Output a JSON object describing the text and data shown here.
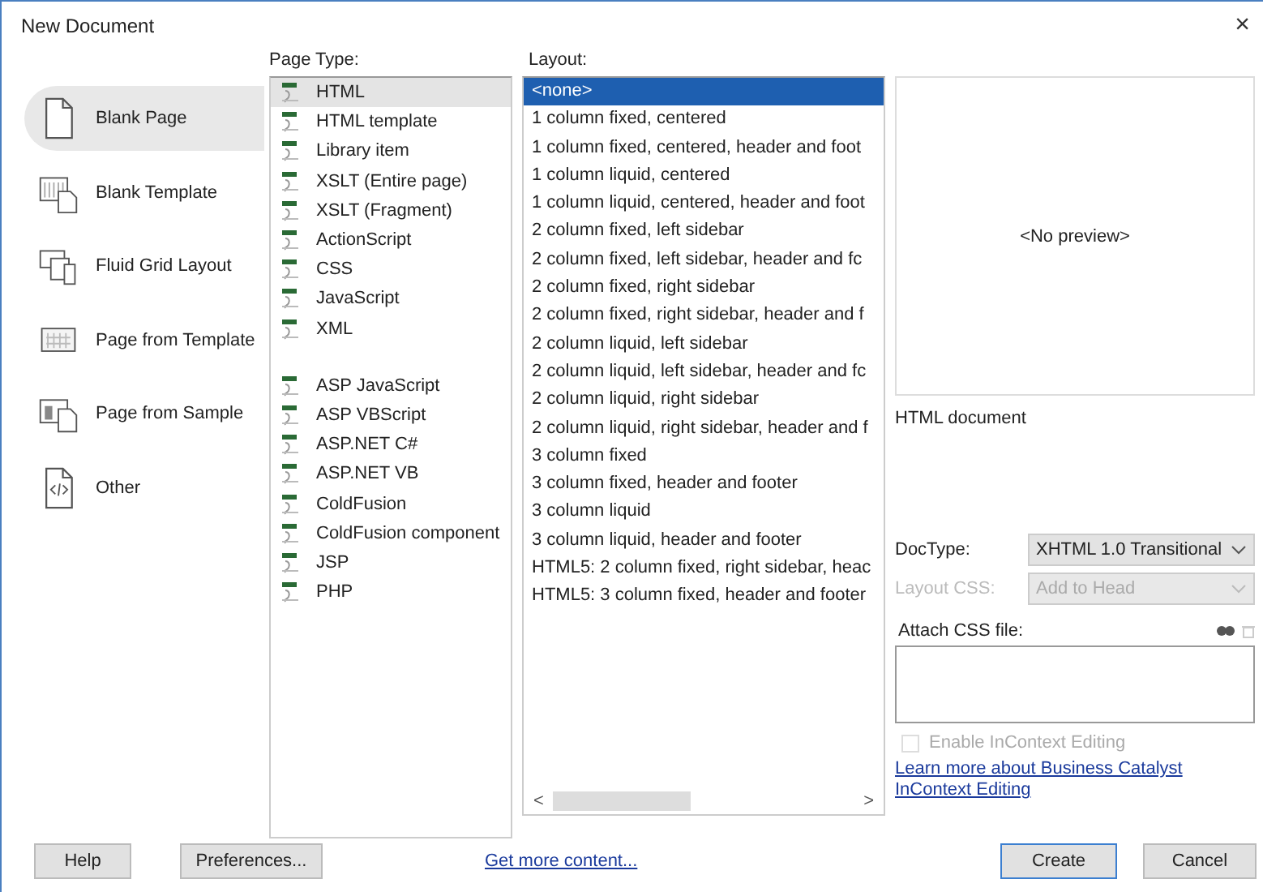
{
  "window": {
    "title": "New Document",
    "close": "×"
  },
  "categories": [
    {
      "label": "Blank Page",
      "kind": "page",
      "selected": true
    },
    {
      "label": "Blank Template",
      "kind": "template",
      "selected": false
    },
    {
      "label": "Fluid Grid Layout",
      "kind": "fluid",
      "selected": false
    },
    {
      "label": "Page from Template",
      "kind": "grid",
      "selected": false
    },
    {
      "label": "Page from Sample",
      "kind": "sample",
      "selected": false
    },
    {
      "label": "Other",
      "kind": "code",
      "selected": false
    }
  ],
  "page_type": {
    "label": "Page Type:",
    "groups": [
      {
        "items": [
          {
            "label": "HTML",
            "selected": true
          },
          {
            "label": "HTML template",
            "selected": false
          },
          {
            "label": "Library item",
            "selected": false
          },
          {
            "label": "XSLT (Entire page)",
            "selected": false
          },
          {
            "label": "XSLT (Fragment)",
            "selected": false
          },
          {
            "label": "ActionScript",
            "selected": false
          },
          {
            "label": "CSS",
            "selected": false
          },
          {
            "label": "JavaScript",
            "selected": false
          },
          {
            "label": "XML",
            "selected": false
          }
        ]
      },
      {
        "items": [
          {
            "label": "ASP JavaScript",
            "selected": false
          },
          {
            "label": "ASP VBScript",
            "selected": false
          },
          {
            "label": "ASP.NET C#",
            "selected": false
          },
          {
            "label": "ASP.NET VB",
            "selected": false
          },
          {
            "label": "ColdFusion",
            "selected": false
          },
          {
            "label": "ColdFusion component",
            "selected": false
          },
          {
            "label": "JSP",
            "selected": false
          },
          {
            "label": "PHP",
            "selected": false
          }
        ]
      }
    ]
  },
  "layout": {
    "label": "Layout:",
    "items": [
      {
        "label": "<none>",
        "selected": true
      },
      {
        "label": "1 column fixed, centered",
        "selected": false
      },
      {
        "label": "1 column fixed, centered, header and foot",
        "selected": false
      },
      {
        "label": "1 column liquid, centered",
        "selected": false
      },
      {
        "label": "1 column liquid, centered, header and foot",
        "selected": false
      },
      {
        "label": "2 column fixed, left sidebar",
        "selected": false
      },
      {
        "label": "2 column fixed, left sidebar, header and fc",
        "selected": false
      },
      {
        "label": "2 column fixed, right sidebar",
        "selected": false
      },
      {
        "label": "2 column fixed, right sidebar, header and f",
        "selected": false
      },
      {
        "label": "2 column liquid, left sidebar",
        "selected": false
      },
      {
        "label": "2 column liquid, left sidebar, header and fc",
        "selected": false
      },
      {
        "label": "2 column liquid, right sidebar",
        "selected": false
      },
      {
        "label": "2 column liquid, right sidebar, header and f",
        "selected": false
      },
      {
        "label": "3 column fixed",
        "selected": false
      },
      {
        "label": "3 column fixed, header and footer",
        "selected": false
      },
      {
        "label": "3 column liquid",
        "selected": false
      },
      {
        "label": "3 column liquid, header and footer",
        "selected": false
      },
      {
        "label": "HTML5: 2 column fixed, right sidebar, heac",
        "selected": false
      },
      {
        "label": "HTML5: 3 column fixed, header and footer",
        "selected": false
      }
    ],
    "scroll_left": "<",
    "scroll_right": ">"
  },
  "preview": {
    "text": "<No preview>",
    "description": "HTML document"
  },
  "options": [
    {
      "label": "DocType:",
      "value": "XHTML 1.0 Transitional",
      "disabled": false
    },
    {
      "label": "Layout CSS:",
      "value": "Add to Head",
      "disabled": true
    }
  ],
  "attach_css": {
    "label": "Attach CSS file:"
  },
  "incontext": {
    "label": "Enable InContext Editing",
    "checked": false,
    "disabled": true
  },
  "learn_link": "Learn more about Business Catalyst InContext Editing",
  "footer": {
    "help": "Help",
    "preferences": "Preferences...",
    "more": "Get more content...",
    "create": "Create",
    "cancel": "Cancel"
  }
}
